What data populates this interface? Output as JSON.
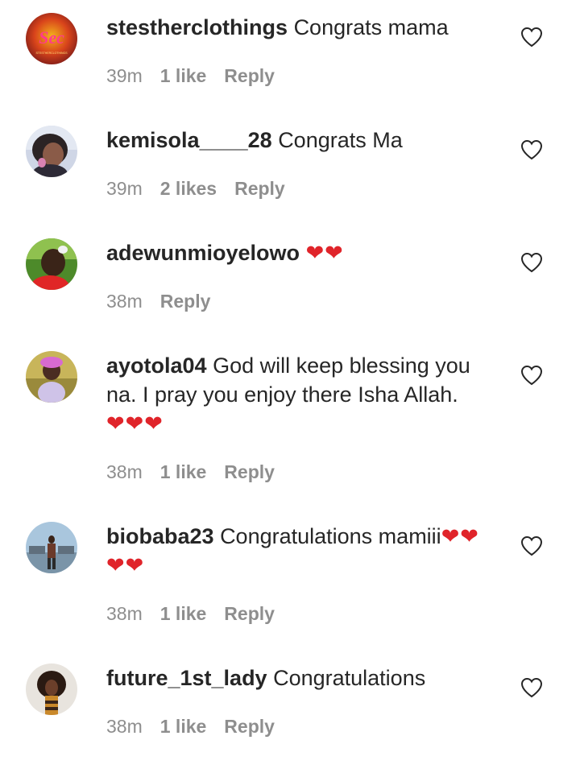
{
  "comments": [
    {
      "username": "stestherclothings",
      "text": "Congrats mama",
      "hearts": "",
      "time": "39m",
      "likes": "1 like",
      "reply": "Reply",
      "avatar_icon": "brand-logo-avatar",
      "avatar_logo_text": "Sec",
      "avatar_sub_text": "STESTHERCLOTHINGS"
    },
    {
      "username": "kemisola____28",
      "text": "Congrats Ma",
      "hearts": "",
      "time": "39m",
      "likes": "2 likes",
      "reply": "Reply",
      "avatar_icon": "person-photo-avatar"
    },
    {
      "username": "adewunmioyelowo",
      "text": "",
      "hearts": "❤❤",
      "time": "38m",
      "likes": "",
      "reply": "Reply",
      "avatar_icon": "person-photo-avatar"
    },
    {
      "username": "ayotola04",
      "text": "God will keep blessing you na. I pray you enjoy there Isha Allah.",
      "hearts": "❤❤❤",
      "time": "38m",
      "likes": "1 like",
      "reply": "Reply",
      "avatar_icon": "person-photo-avatar"
    },
    {
      "username": "biobaba23",
      "text": "Congratulations mamiii",
      "hearts": "❤❤❤❤",
      "time": "38m",
      "likes": "1 like",
      "reply": "Reply",
      "avatar_icon": "person-photo-avatar"
    },
    {
      "username": "future_1st_lady",
      "text": "Congratulations",
      "hearts": "",
      "time": "38m",
      "likes": "1 like",
      "reply": "Reply",
      "avatar_icon": "person-photo-avatar"
    }
  ],
  "colors": {
    "text": "#262626",
    "meta": "#8e8e8e",
    "heart_emoji": "#e0242a",
    "like_outline": "#262626"
  },
  "icons": {
    "like": "heart-outline-icon"
  }
}
